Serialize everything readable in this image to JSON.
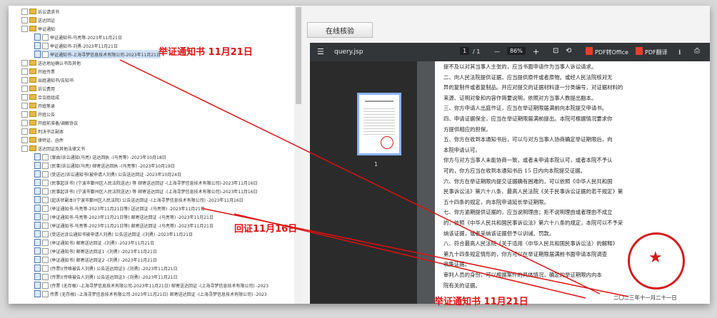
{
  "tree": {
    "rows": [
      {
        "label": "诉讼请求书",
        "type": "folder"
      },
      {
        "label": "送达回证",
        "type": "folder"
      },
      {
        "label": "举证通知",
        "type": "folder"
      },
      {
        "label": "举证通知书-马亮等-2023年11月21日",
        "type": "doc"
      },
      {
        "label": "举证通知书-刘勇-2023年11月21日",
        "type": "doc"
      },
      {
        "label": "举证通知书-上海寻梦信息技术有限公司-2023年11月21日",
        "type": "doc",
        "selected": true
      },
      {
        "label": "送达地址确认书及其他",
        "type": "folder"
      },
      {
        "label": "开庭传票",
        "type": "folder"
      },
      {
        "label": "出庭通知书/告知书",
        "type": "folder"
      },
      {
        "label": "诉讼费用",
        "type": "folder"
      },
      {
        "label": "合议庭组成",
        "type": "folder"
      },
      {
        "label": "开庭笔录",
        "type": "folder"
      },
      {
        "label": "开庭公告",
        "type": "folder"
      },
      {
        "label": "开庭前准备/调解协议",
        "type": "folder"
      },
      {
        "label": "判决书正副本",
        "type": "folder"
      },
      {
        "label": "律师证、函件",
        "type": "folder"
      },
      {
        "label": "送达回证及其他法律文书",
        "type": "folder"
      },
      {
        "label": "(案由)诉讼通知(马亮) 送达回执 -(马亮等) -2023年10月18日",
        "type": "doc"
      },
      {
        "label": "(民事)诉讼通知(马亮) 邮寄送达回执 -(马亮等) -2023年10月19日",
        "type": "doc"
      },
      {
        "label": "(受送达)诉讼通知书(被申请人刘勇) 公告送达回证 -2023年10月24日",
        "type": "doc"
      },
      {
        "label": "(民事起诉书) (宁波市鄞州区人民法院送达) 等 邮寄送达回证 -(上海寻梦信息技术有限公司)-2023年11月16日",
        "type": "doc"
      },
      {
        "label": "(民事起诉书) (宁波市鄞州区人民法院送达) 等 邮寄送达回证 -(上海寻梦信息技术有限公司)-2023年11月16日",
        "type": "doc"
      },
      {
        "label": "(起诉状副本)(宁波市鄞州区人民法院) 公告送达回证 -(上海寻梦信息技术有限公司) -2023年11月16日",
        "type": "doc"
      },
      {
        "label": "(举证通知书-马亮等-2023年11月21日等) 送达回证 -(马亮等) -2023年11月21日",
        "type": "doc"
      },
      {
        "label": "(举证通知书-马亮等-2023年11月21日等) 邮寄送达回证 -(马亮等) -2023年11月21日",
        "type": "doc"
      },
      {
        "label": "(举证通知书-马亮等-2023年11月21日等) 邮寄送达回证 -(马亮等) -2023年11月21日",
        "type": "doc"
      },
      {
        "label": "(受送达诉讼通知书被申请人刘勇) 公告送达回证 -(刘勇) -2023年11月21日",
        "type": "doc"
      },
      {
        "label": "(举证通知书) 邮寄送达回证 -(刘勇) -2023年11月21日",
        "type": "doc"
      },
      {
        "label": "(举证通知书) 邮寄送达回证1 -(刘勇) -2023年11月21日",
        "type": "doc"
      },
      {
        "label": "(举证通知书) 邮寄送达回证2 -(刘勇) -2023年11月21日",
        "type": "doc"
      },
      {
        "label": "(传票)(传唤被告人刘勇) 公告送达回证3 -(刘勇) -2023年11月21日",
        "type": "doc"
      },
      {
        "label": "(传票)(传唤被告人刘勇) 公告送达回证3 -(刘勇) -2023年11月21日",
        "type": "doc"
      },
      {
        "label": "(传票 (无存根) -上海寻梦信息技术有限公司-2023年11月21日) 邮寄送达回证 -(上海寻梦信息技术有限公司) -2023",
        "type": "doc"
      },
      {
        "label": "传票 (无存根) -上海寻梦信息技术有限公司-2023年11月21日) 邮寄送达回证 -(上海寻梦信息技术有限公司) -2023",
        "type": "doc"
      }
    ]
  },
  "right": {
    "online_btn": "在线核验"
  },
  "pdf": {
    "file": "query.jsp",
    "page": "1",
    "pages": "/ 1",
    "zoom": "86%",
    "minus": "—",
    "plus": "+",
    "to_office": "PDF转Office",
    "translate": "PDF翻译",
    "thumb_label": "1"
  },
  "doc_text": [
    "提不及以对其当事人主张的，应当书面申请作为当事人诉讼请求。",
    "二、向人民法院提供证据，应当提供原件或者原物。或经人民法院核对无",
    "异的复制件或者复制品。并应对提交的证据材料逐一分类编号，对证据材料的",
    "来源、证明对象和内容作简要说明，依照对方当事人数提出副本。",
    "三、你方申请人出庭作证，应当在举证期限届满前向本院提交申请书。",
    "四、申请证据保全，应当在举证期限届满前提出。本院可根据情况要求你",
    "方提供相应的担保。",
    "五、你方在收到本通知书后，可以与对方当事人协商确定举证期限后，向",
    "本院申请认可。",
    "你方与对方当事人未能协商一致，或者未申请本院认可，或者本院不予认",
    "可的，你方应当在收到本通知书后 15 日内向本院提交证据。",
    "六、你方在举证期限内提交证据确有困难的，可以依照《中华人民共和国",
    "民事诉讼法》第六十八条、最高人民法院《关于民事诉讼证据的若干规定》第",
    "五十四条的规定，向本院申请延长举证期限。",
    "七、你方逾期提供证据的，应当说明理由；拒不说明理由或者理由不成立",
    "的，依照《中华人民共和国民事诉讼法》第六十八条的规定，本院可以不予采",
    "纳该证据，或者采纳该证据但予以训诫、罚款。",
    "八、符合最高人民法院《关于适用〈中华人民共和国民事诉讼法〉的解释》",
    "第九十四条规定情形的，你方可以在举证期限届满前书面申请本院调查",
    "收集证据。",
    "审判人员的身份，可以根据案件的具体情况，确定的举证期限内向本",
    "院有关的证据。"
  ],
  "seal_date": "二〇二三年十一月二十一日",
  "annotations": {
    "a1": "举证通知书  11月21日",
    "a2": "回证11月16日",
    "a3": "举证通知书  11月21日"
  },
  "colors": {
    "annotation": "#e01010",
    "seal": "#d61a1a"
  }
}
